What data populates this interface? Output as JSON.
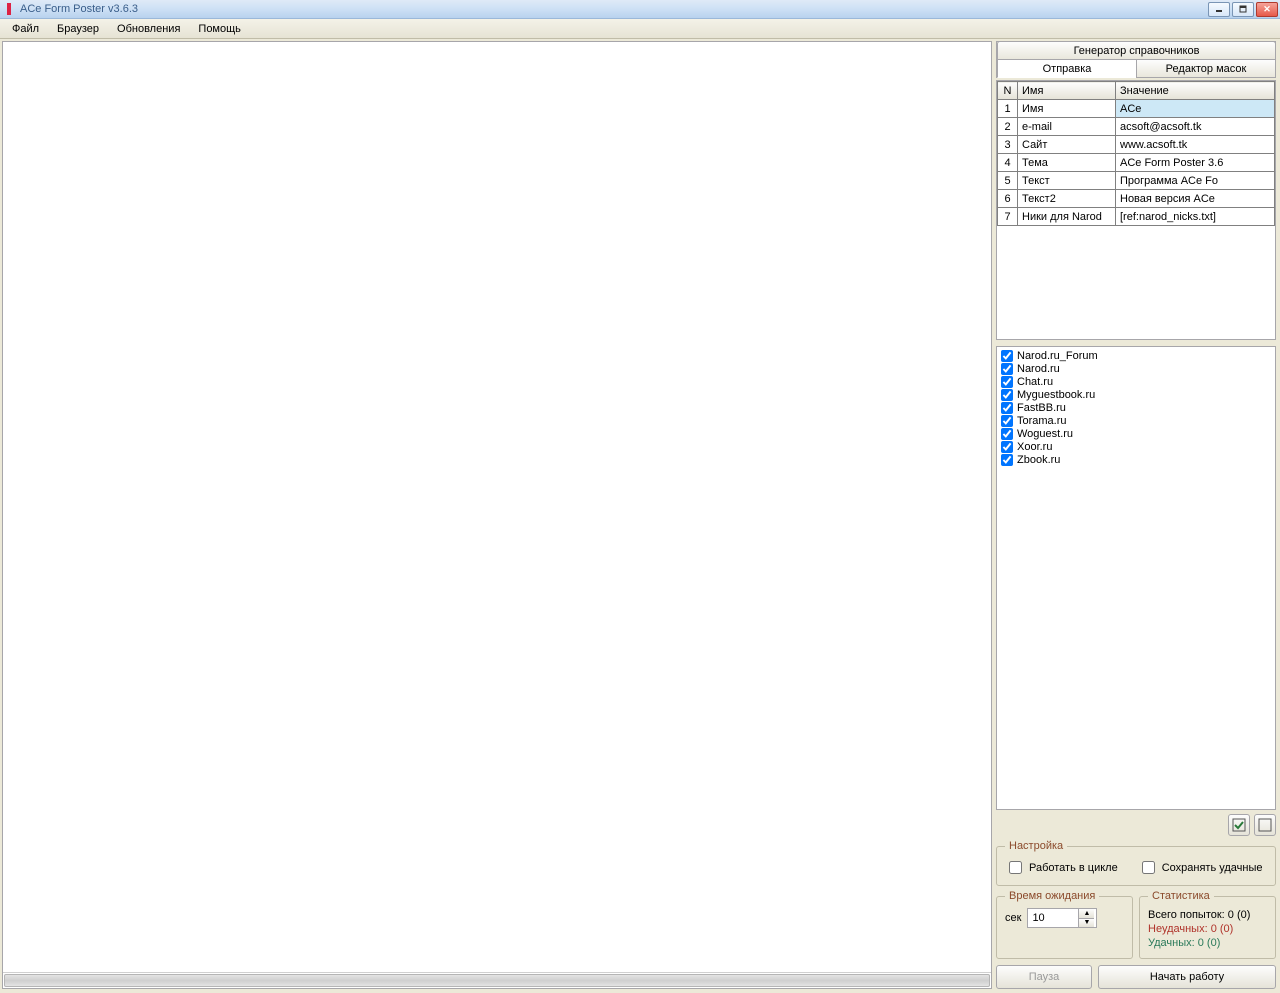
{
  "window": {
    "title": "ACe Form Poster v3.6.3"
  },
  "menu": {
    "file": "Файл",
    "browser": "Браузер",
    "updates": "Обновления",
    "help": "Помощь"
  },
  "tabs": {
    "generator": "Генератор справочников",
    "send": "Отправка",
    "masks": "Редактор масок"
  },
  "params": {
    "header_n": "N",
    "header_name": "Имя",
    "header_value": "Значение",
    "rows": [
      {
        "n": "1",
        "name": "Имя",
        "value": "ACe"
      },
      {
        "n": "2",
        "name": "e-mail",
        "value": "acsoft@acsoft.tk"
      },
      {
        "n": "3",
        "name": "Сайт",
        "value": "www.acsoft.tk"
      },
      {
        "n": "4",
        "name": "Тема",
        "value": "ACe Form Poster 3.6"
      },
      {
        "n": "5",
        "name": "Текст",
        "value": "Программа ACe Fo"
      },
      {
        "n": "6",
        "name": "Текст2",
        "value": "Новая версия ACe"
      },
      {
        "n": "7",
        "name": "Ники для Narod",
        "value": "[ref:narod_nicks.txt]"
      }
    ]
  },
  "sites": [
    "Narod.ru_Forum",
    "Narod.ru",
    "Chat.ru",
    "Myguestbook.ru",
    "FastBB.ru",
    "Torama.ru",
    "Woguest.ru",
    "Xoor.ru",
    "Zbook.ru"
  ],
  "settings": {
    "legend": "Настройка",
    "loop": "Работать в цикле",
    "saveok": "Сохранять удачные"
  },
  "wait": {
    "legend": "Время ожидания",
    "sec_label": "сек",
    "sec_value": "10"
  },
  "stats": {
    "legend": "Статистика",
    "total": "Всего попыток: 0 (0)",
    "fail": "Неудачных: 0 (0)",
    "ok": "Удачных: 0 (0)"
  },
  "buttons": {
    "pause": "Пауза",
    "start": "Начать работу"
  }
}
